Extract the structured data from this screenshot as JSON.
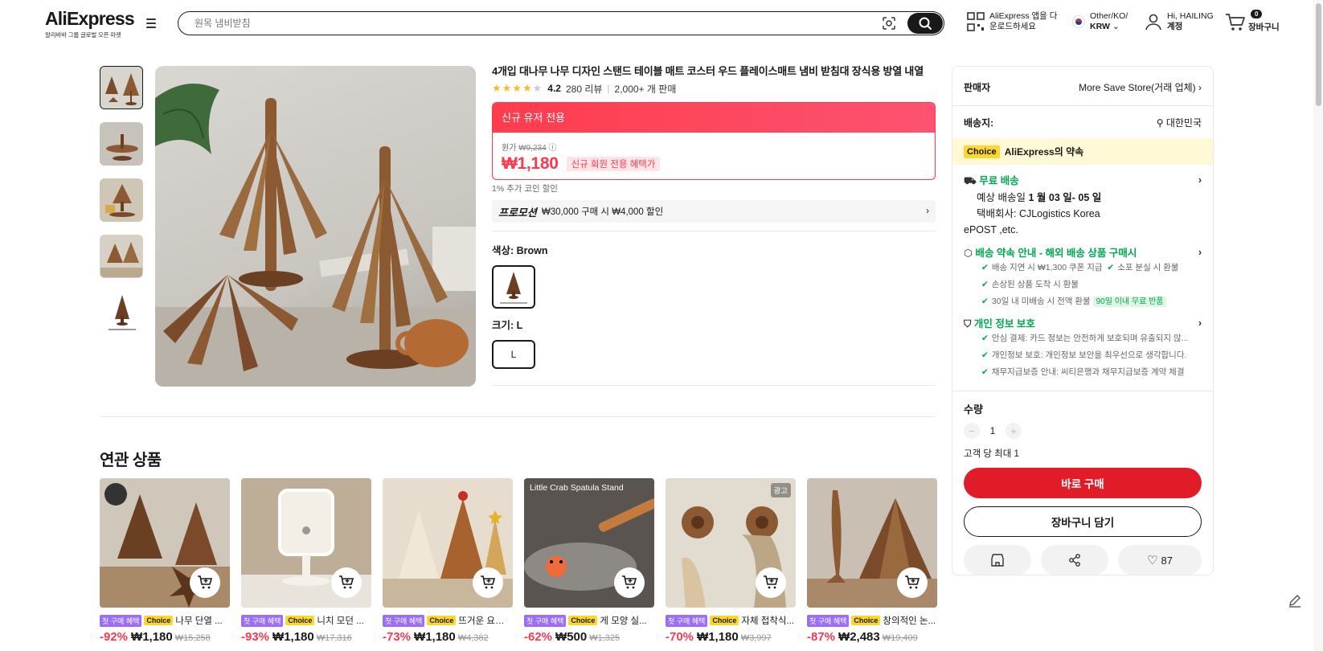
{
  "header": {
    "logo": "AliExpress",
    "logo_sub": "알리바바 그룹 글로벌 오픈 마켓",
    "search_placeholder": "원목 냄비받침",
    "app_line1": "AliExpress 앱을 다",
    "app_line2": "운로드하세요",
    "region_line1": "Other/KO/",
    "region_line2": "KRW",
    "account_line1": "Hi, HAILING",
    "account_line2": "계정",
    "cart_count": "0",
    "cart_label": "장바구니"
  },
  "product": {
    "title": "4개입 대나무 나무 디자인 스탠드 테이블 매트 코스터 우드 플레이스매트 냄비 받침대 장식용 방열 내열",
    "rating": "4.2",
    "reviews": "280 리뷰",
    "sold": "2,000+ 개 판매",
    "new_user_label": "신규 유저 전용",
    "orig_label": "원가",
    "orig_price": "₩9,234",
    "price": "₩1,180",
    "price_tag": "신규 회원 전용 혜택가",
    "coin_note": "1% 추가 코인 할인",
    "promo_label": "프로모션",
    "promo_text": "₩30,000 구매 시 ₩4,000 할인",
    "color_label": "색상: Brown",
    "size_label": "크기: L",
    "size_value": "L"
  },
  "panel": {
    "seller_label": "판매자",
    "seller_value": "More Save Store(거래 업체)",
    "ship_label": "배송지:",
    "ship_value": "대한민국",
    "choice_tag": "Choice",
    "choice_text": "AliExpress의 약속",
    "free_ship": "무료 배송",
    "eta_prefix": "예상 배송일",
    "eta_value": "1 월 03 일- 05 일",
    "carrier_line1": "택배회사:    CJLogistics     Korea",
    "carrier_line2": "ePOST ,etc.",
    "guarantee_title": "배송 약속 안내 - 해외 배송 상품 구매시",
    "g1": "배송 지연 시 ₩1,300 쿠폰 지급",
    "g2": "소포 분실 시 환불",
    "g3": "손상된 상품 도착 시 환불",
    "g4": "30일 내 미배송 시 전액 환불",
    "g4_tag": "90일 이내 무료 반품",
    "privacy_title": "개인 정보 보호",
    "p1": "안심 결제: 카드 정보는 안전하게 보호되며 유출되지 않...",
    "p2": "개인정보 보호: 개인정보 보안을 최우선으로 생각합니다.",
    "p3": "채무지급보증 안내: 씨티은행과 채무지급보증 계약 체결",
    "qty_label": "수량",
    "qty_value": "1",
    "qty_limit": "고객 당 최대 1",
    "buy_now": "바로 구매",
    "add_cart": "장바구니 담기",
    "wish_count": "87"
  },
  "related": {
    "title": "연관 상품",
    "first_tag": "첫 구매 혜택",
    "choice_tag": "Choice",
    "ad_tag": "광고",
    "items": [
      {
        "name": "나무 단열 ...",
        "disc": "-92%",
        "price": "₩1,180",
        "orig": "₩15,258"
      },
      {
        "name": "니치 모던 ...",
        "disc": "-93%",
        "price": "₩1,180",
        "orig": "₩17,316"
      },
      {
        "name": "뜨거운 요리용 나...",
        "disc": "-73%",
        "price": "₩1,180",
        "orig": "₩4,382"
      },
      {
        "name": "게 모양 실...",
        "disc": "-62%",
        "price": "₩500",
        "orig": "₩1,325"
      },
      {
        "name": "자체 접착식...",
        "disc": "-70%",
        "price": "₩1,180",
        "orig": "₩3,997"
      },
      {
        "name": "창의적인 논...",
        "disc": "-87%",
        "price": "₩2,483",
        "orig": "₩19,409"
      }
    ],
    "crab_caption": "Little Crab Spatula Stand"
  },
  "colors": {
    "accent_red": "#fd384f",
    "buy_red": "#e21b28",
    "choice_yellow": "#fdd62e",
    "green": "#00a650",
    "star": "#fdb92c"
  }
}
